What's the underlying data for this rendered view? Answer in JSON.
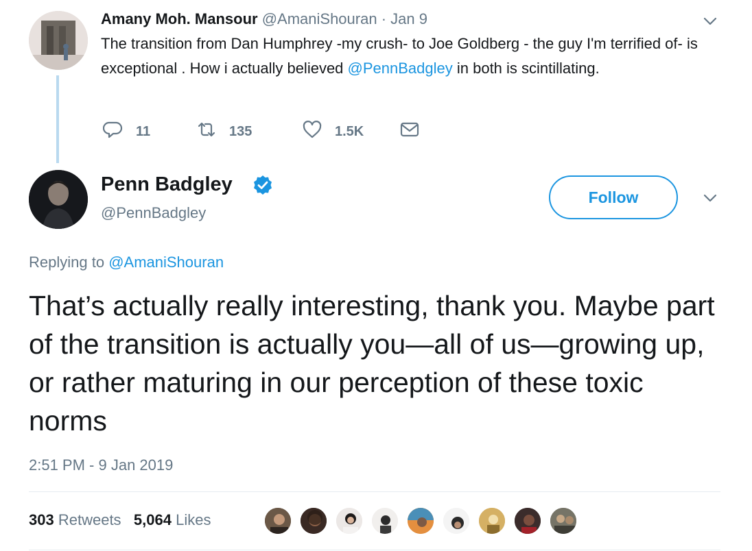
{
  "parent_tweet": {
    "author_name": "Amany Moh. Mansour",
    "author_handle": "@AmaniShouran",
    "separator": "·",
    "date": "Jan 9",
    "text_before": "The transition from Dan Humphrey -my crush- to Joe Goldberg - the guy I'm terrified of- is exceptional . How i actually believed ",
    "mention": "@PennBadgley",
    "text_after": " in both is scintillating.",
    "reply_count": "11",
    "retweet_count": "135",
    "like_count": "1.5K"
  },
  "main_tweet": {
    "author_name": "Penn Badgley",
    "author_handle": "@PennBadgley",
    "follow_label": "Follow",
    "replying_prefix": "Replying to ",
    "replying_handle": "@AmaniShouran",
    "text": "That’s actually really interesting, thank you. Maybe part of the transition is actually you—all of us—growing up, or rather maturing in our perception of these toxic norms",
    "timestamp": "2:51 PM - 9 Jan 2019",
    "retweets_count": "303",
    "retweets_label": "Retweets",
    "likes_count": "5,064",
    "likes_label": "Likes"
  },
  "colors": {
    "accent": "#1b95e0",
    "muted": "#657786",
    "text": "#14171a",
    "thread_line": "#b9d9ef"
  },
  "icons": {
    "reply": "reply-icon",
    "retweet": "retweet-icon",
    "like": "heart-icon",
    "dm": "envelope-icon",
    "menu": "chevron-down-icon",
    "verified": "verified-badge-icon"
  }
}
